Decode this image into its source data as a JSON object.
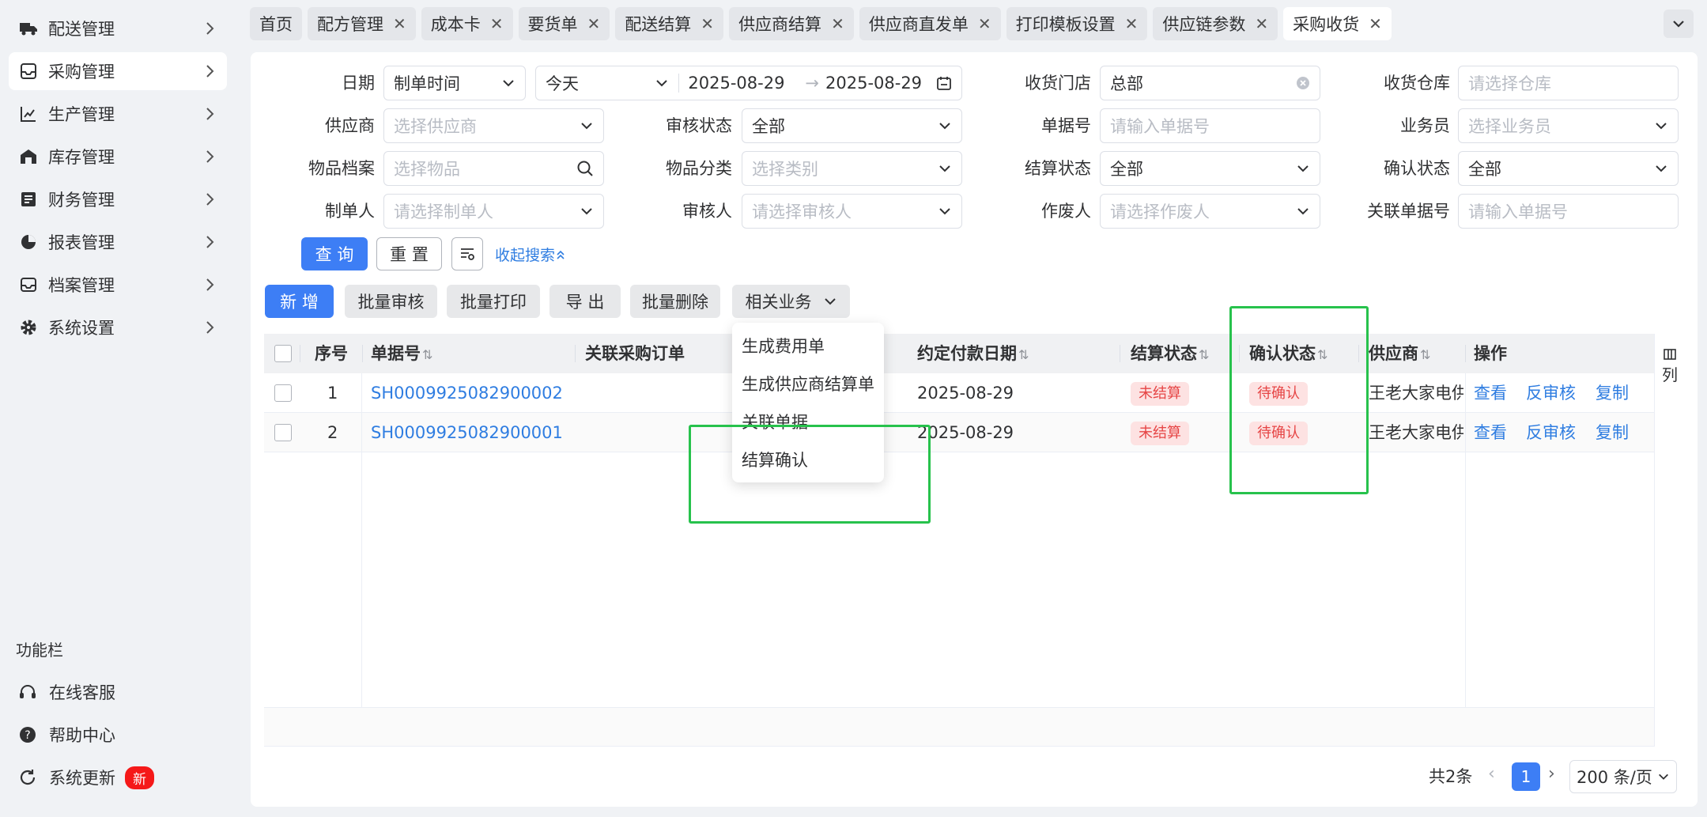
{
  "sidebar": {
    "items": [
      {
        "label": "配送管理",
        "icon": "truck-icon"
      },
      {
        "label": "采购管理",
        "icon": "inbox-icon"
      },
      {
        "label": "生产管理",
        "icon": "chart-icon"
      },
      {
        "label": "库存管理",
        "icon": "warehouse-icon"
      },
      {
        "label": "财务管理",
        "icon": "finance-icon"
      },
      {
        "label": "报表管理",
        "icon": "pie-icon"
      },
      {
        "label": "档案管理",
        "icon": "archive-icon"
      },
      {
        "label": "系统设置",
        "icon": "gear-icon"
      }
    ],
    "func_title": "功能栏",
    "func_items": [
      {
        "label": "在线客服",
        "icon": "headset-icon"
      },
      {
        "label": "帮助中心",
        "icon": "help-icon"
      },
      {
        "label": "系统更新",
        "icon": "refresh-icon",
        "badge": "新"
      }
    ]
  },
  "tabs": [
    {
      "label": "首页",
      "closable": false
    },
    {
      "label": "配方管理",
      "closable": true
    },
    {
      "label": "成本卡",
      "closable": true
    },
    {
      "label": "要货单",
      "closable": true
    },
    {
      "label": "配送结算",
      "closable": true
    },
    {
      "label": "供应商结算",
      "closable": true
    },
    {
      "label": "供应商直发单",
      "closable": true
    },
    {
      "label": "打印模板设置",
      "closable": true
    },
    {
      "label": "供应链参数",
      "closable": true
    },
    {
      "label": "采购收货",
      "closable": true,
      "active": true
    }
  ],
  "filters": {
    "date_label": "日期",
    "date_type": "制单时间",
    "date_range": "今天",
    "date_start": "2025-08-29",
    "date_end": "2025-08-29",
    "store_label": "收货门店",
    "store_value": "总部",
    "warehouse_label": "收货仓库",
    "warehouse_ph": "请选择仓库",
    "supplier_label": "供应商",
    "supplier_ph": "选择供应商",
    "audit_label": "审核状态",
    "audit_value": "全部",
    "docno_label": "单据号",
    "docno_ph": "请输入单据号",
    "salesman_label": "业务员",
    "salesman_ph": "选择业务员",
    "item_label": "物品档案",
    "item_ph": "选择物品",
    "category_label": "物品分类",
    "category_ph": "选择类别",
    "settle_label": "结算状态",
    "settle_value": "全部",
    "confirm_label": "确认状态",
    "confirm_value": "全部",
    "creator_label": "制单人",
    "creator_ph": "请选择制单人",
    "auditor_label": "审核人",
    "auditor_ph": "请选择审核人",
    "voider_label": "作废人",
    "voider_ph": "请选择作废人",
    "related_label": "关联单据号",
    "related_ph": "请输入单据号",
    "query_btn": "查 询",
    "reset_btn": "重 置",
    "collapse_link": "收起搜索"
  },
  "toolbar": {
    "add": "新 增",
    "batch_audit": "批量审核",
    "batch_print": "批量打印",
    "export": "导 出",
    "batch_delete": "批量删除",
    "related": "相关业务"
  },
  "dropdown": [
    "生成费用单",
    "生成供应商结算单",
    "关联单据",
    "结算确认"
  ],
  "table": {
    "headers": {
      "seq": "序号",
      "docno": "单据号",
      "po": "关联采购订单",
      "paydate": "约定付款日期",
      "settle": "结算状态",
      "confirm": "确认状态",
      "supplier": "供应商",
      "ops": "操作",
      "cols": "列"
    },
    "rows": [
      {
        "seq": "1",
        "docno": "SH0009925082900002",
        "paydate": "2025-08-29",
        "settle": "未结算",
        "confirm": "待确认",
        "supplier": "王老大家电供",
        "view": "查看",
        "unaudit": "反审核",
        "copy": "复制"
      },
      {
        "seq": "2",
        "docno": "SH0009925082900001",
        "paydate": "2025-08-29",
        "settle": "未结算",
        "confirm": "待确认",
        "supplier": "王老大家电供",
        "view": "查看",
        "unaudit": "反审核",
        "copy": "复制"
      }
    ]
  },
  "pagination": {
    "total": "共2条",
    "page": "1",
    "size": "200 条/页"
  },
  "colors": {
    "primary": "#3d7ef5",
    "link": "#2f7de1",
    "tag_bg": "#fde2e2",
    "tag_text": "#e64545",
    "highlight": "#27c24c"
  }
}
